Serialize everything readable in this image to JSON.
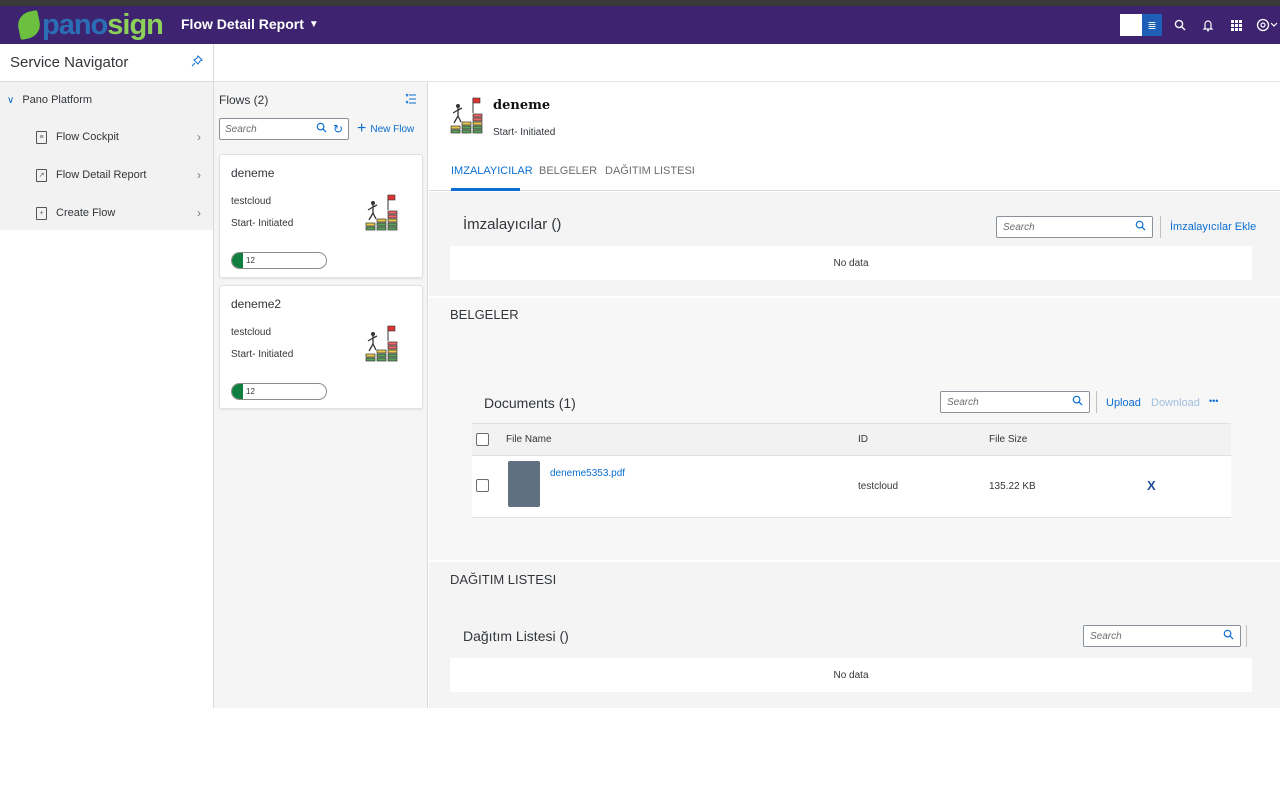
{
  "shell": {
    "logo_left": "pano",
    "logo_right": "sign",
    "app_title": "Flow Detail Report",
    "dropdown_glyph": "▼",
    "icons": [
      "layout-icon",
      "search-icon",
      "bell-icon",
      "apps-grid-icon",
      "settings-icon"
    ]
  },
  "nav": {
    "title": "Service Navigator",
    "group": "Pano Platform",
    "items": [
      {
        "label": "Flow Cockpit",
        "icon": "document-icon"
      },
      {
        "label": "Flow Detail Report",
        "icon": "report-icon"
      },
      {
        "label": "Create Flow",
        "icon": "new-document-icon"
      }
    ]
  },
  "flows": {
    "header": "Flows (2)",
    "search_placeholder": "Search",
    "new_flow_label": "New Flow",
    "items": [
      {
        "name": "deneme",
        "owner": "testcloud",
        "status": "Start- Initiated",
        "progress_label": "12",
        "progress_percent": 12
      },
      {
        "name": "deneme2",
        "owner": "testcloud",
        "status": "Start- Initiated",
        "progress_label": "12",
        "progress_percent": 12
      }
    ]
  },
  "detail": {
    "title": "deneme",
    "subtitle": "Start- Initiated",
    "tabs": [
      "IMZALAYICILAR",
      "BELGELER",
      "DAĞITIM LISTESI"
    ],
    "active_tab": "IMZALAYICILAR",
    "signers": {
      "title": "İmzalayıcılar ()",
      "search_placeholder": "Search",
      "add_label": "İmzalayıcılar Ekle",
      "empty_text": "No data"
    },
    "documents_section": {
      "section_title": "BELGELER",
      "table_title": "Documents (1)",
      "search_placeholder": "Search",
      "upload_label": "Upload",
      "download_label": "Download",
      "more_glyph": "•••",
      "columns": {
        "file_name": "File Name",
        "id": "ID",
        "file_size": "File Size"
      },
      "rows": [
        {
          "file_name": "deneme5353.pdf",
          "id": "testcloud",
          "file_size": "135.22 KB",
          "delete_glyph": "X"
        }
      ]
    },
    "distribution": {
      "section_title": "DAĞITIM LISTESI",
      "title": "Dağıtım Listesi ()",
      "search_placeholder": "Search",
      "empty_text": "No data"
    }
  },
  "colors": {
    "shellbar": "#3d2370",
    "accent": "#0a6ed1",
    "progress": "#107e3e"
  }
}
